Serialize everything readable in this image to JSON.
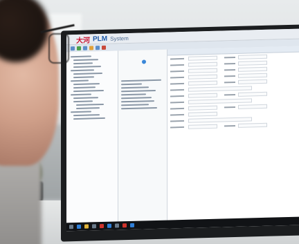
{
  "app": {
    "logo_mark": "大河",
    "logo_text": "PLM",
    "logo_suffix": "System"
  }
}
